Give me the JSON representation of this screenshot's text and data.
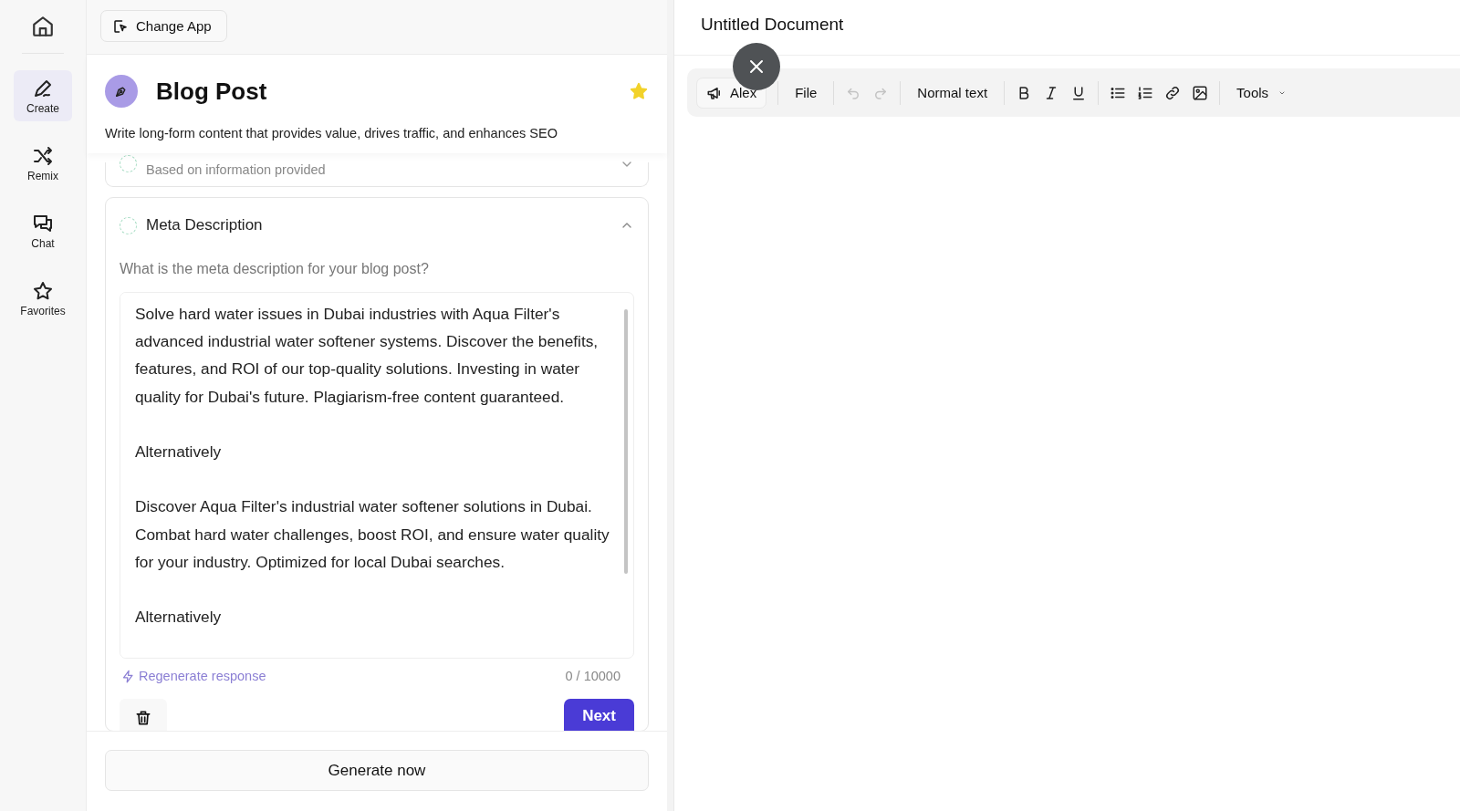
{
  "nav": {
    "items": [
      {
        "label": "Create",
        "selected": true
      },
      {
        "label": "Remix",
        "selected": false
      },
      {
        "label": "Chat",
        "selected": false
      },
      {
        "label": "Favorites",
        "selected": false
      }
    ]
  },
  "change_app": "Change App",
  "app": {
    "title": "Blog Post",
    "favorite": true,
    "description": "Write long-form content that provides value, drives traffic, and enhances SEO"
  },
  "steps": [
    {
      "subtitle": "Based on information provided",
      "expanded": false
    },
    {
      "title": "Meta Description",
      "expanded": true,
      "question": "What is the meta description for your blog post?",
      "value": "Solve hard water issues in Dubai industries with Aqua Filter's advanced industrial water softener systems. Discover the benefits, features, and ROI of our top-quality solutions. Investing in water quality for Dubai's future. Plagiarism-free content guaranteed.\n\nAlternatively\n\nDiscover Aqua Filter's industrial water softener solutions in Dubai. Combat hard water challenges, boost ROI, and ensure water quality for your industry. Optimized for local Dubai searches.\n\nAlternatively",
      "regenerate": "Regenerate response",
      "count": "0 / 10000",
      "next": "Next"
    }
  ],
  "generate": "Generate now",
  "document": {
    "title": "Untitled Document"
  },
  "toolbar": {
    "profile": "Alex",
    "file": "File",
    "style": "Normal text",
    "tools": "Tools"
  }
}
